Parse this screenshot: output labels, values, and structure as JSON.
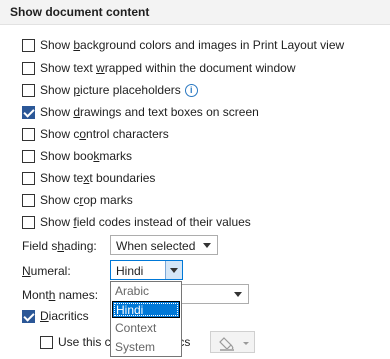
{
  "section": {
    "title": "Show document content"
  },
  "checkboxes": [
    {
      "pre": "Show ",
      "ul": "b",
      "post": "ackground colors and images in Print Layout view",
      "checked": false
    },
    {
      "pre": "Show text ",
      "ul": "w",
      "post": "rapped within the document window",
      "checked": false
    },
    {
      "pre": "Show ",
      "ul": "p",
      "post": "icture placeholders",
      "checked": false,
      "info_icon": "info-icon"
    },
    {
      "pre": "Show ",
      "ul": "d",
      "post": "rawings and text boxes on screen",
      "checked": true
    },
    {
      "pre": "Show c",
      "ul": "o",
      "post": "ntrol characters",
      "checked": false
    },
    {
      "pre": "Show boo",
      "ul": "k",
      "post": "marks",
      "checked": false
    },
    {
      "pre": "Show te",
      "ul": "x",
      "post": "t boundaries",
      "checked": false
    },
    {
      "pre": "Show c",
      "ul": "r",
      "post": "op marks",
      "checked": false
    },
    {
      "pre": "Show ",
      "ul": "f",
      "post": "ield codes instead of their values",
      "checked": false
    }
  ],
  "field_shading": {
    "pre": "Field s",
    "ul": "h",
    "post": "ading:",
    "value": "When selected"
  },
  "numeral": {
    "pre": "",
    "ul": "N",
    "post": "umeral:",
    "value": "Hindi"
  },
  "month_names": {
    "pre": "Mont",
    "ul": "h",
    "post": " names:"
  },
  "diacritics": {
    "pre": "",
    "ul": "D",
    "post": "iacritics",
    "checked": true
  },
  "use_this_color": {
    "pre": "Use this c",
    "post": "ics",
    "checked": false
  },
  "numeral_options": [
    {
      "label": "Arabic",
      "selected": false
    },
    {
      "label": "Hindi",
      "selected": true
    },
    {
      "label": "Context",
      "selected": false
    },
    {
      "label": "System",
      "selected": false
    }
  ],
  "colors": {
    "accent": "#0078d7",
    "checkbox_checked": "#2b5797",
    "header_bg": "#f3f3f3"
  },
  "icons": {
    "info": "info-icon",
    "paint_bucket": "paint-bucket-icon",
    "dropdown_arrow": "chevron-down-icon"
  }
}
